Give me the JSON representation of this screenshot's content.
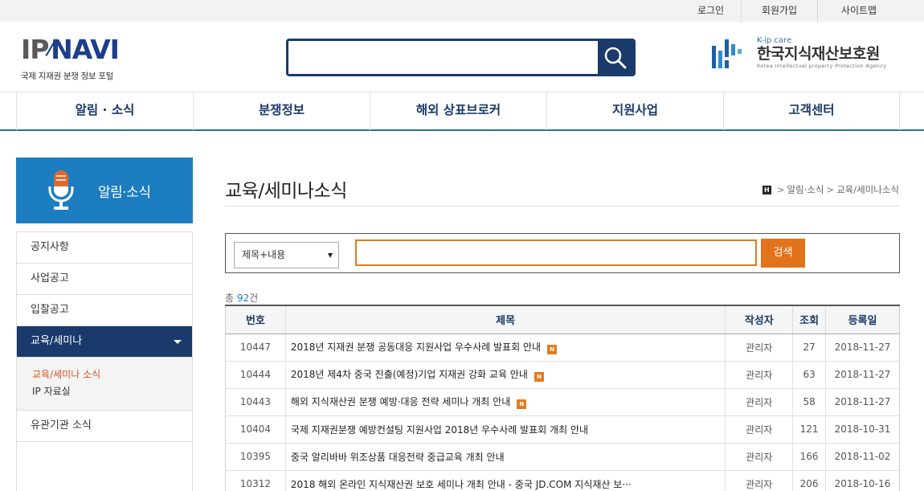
{
  "utility": {
    "login": "로그인",
    "join": "회원가입",
    "sitemap": "사이트맵"
  },
  "logo": {
    "main_a": "IP",
    "main_b": "NAVI",
    "sub": "국제 지재권 분쟁 정보 포털"
  },
  "search": {
    "value": ""
  },
  "partner": {
    "small": "K-ip care",
    "title": "한국지식재산보호원",
    "en": "Korea Intellectual property Protection Agency"
  },
  "nav": {
    "items": [
      "알림 · 소식",
      "분쟁정보",
      "해외 상표브로커",
      "지원사업",
      "고객센터"
    ]
  },
  "sidebar": {
    "title": "알림·소식",
    "items": [
      "공지사항",
      "사업공고",
      "입찰공고",
      "교육/세미나"
    ],
    "sub_items": [
      "교육/세미나 소식",
      "IP 자료실"
    ],
    "last_item": "유관기관 소식"
  },
  "page": {
    "title": "교육/세미나소식",
    "breadcrumb": [
      "알림·소식",
      "교육/세미나소식"
    ]
  },
  "filter": {
    "selected": "제목+내용",
    "keyword": "",
    "button": "검색"
  },
  "total": {
    "prefix": "총",
    "count": "92",
    "suffix": "건"
  },
  "table": {
    "headers": [
      "번호",
      "제목",
      "작성자",
      "조회",
      "등록일"
    ],
    "new_badge": "N",
    "rows": [
      {
        "no": "10447",
        "title": "2018년 지재권 분쟁 공동대응 지원사업 우수사례 발표회 안내",
        "author": "관리자",
        "views": "27",
        "date": "2018-11-27",
        "is_new": true
      },
      {
        "no": "10444",
        "title": "2018년 제4차 중국 진출(예정)기업 지재권 강화 교육 안내",
        "author": "관리자",
        "views": "63",
        "date": "2018-11-27",
        "is_new": true
      },
      {
        "no": "10443",
        "title": "해외 지식재산권 분쟁 예방·대응 전략 세미나 개최 안내",
        "author": "관리자",
        "views": "58",
        "date": "2018-11-27",
        "is_new": true
      },
      {
        "no": "10404",
        "title": "국제 지재권분쟁 예방컨설팅 지원사업 2018년 우수사례 발표회 개최 안내",
        "author": "관리자",
        "views": "121",
        "date": "2018-10-31",
        "is_new": false
      },
      {
        "no": "10395",
        "title": "중국 알리바바 위조상품 대응전략 중급교육 개최 안내",
        "author": "관리자",
        "views": "166",
        "date": "2018-11-02",
        "is_new": false
      },
      {
        "no": "10312",
        "title": "2018 해외 온라인 지식재산권 보호 세미나 개최 안내 - 중국 JD.COM 지식재산 보···",
        "author": "관리자",
        "views": "206",
        "date": "2018-10-16",
        "is_new": false
      }
    ]
  },
  "colors": {
    "navy": "#1a3a6b",
    "blue": "#1c7dc0",
    "orange": "#e3731b"
  }
}
